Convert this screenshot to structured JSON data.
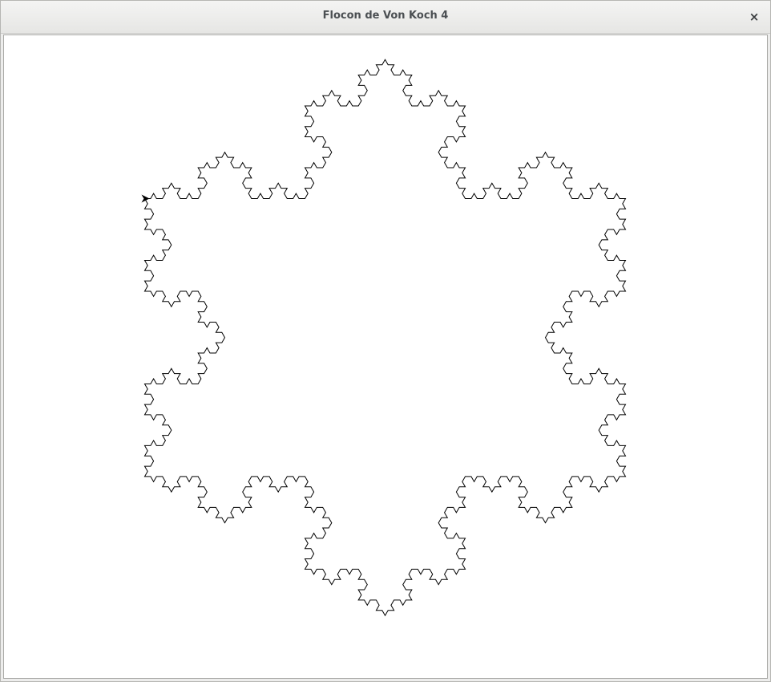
{
  "window": {
    "title": "Flocon de Von Koch 4",
    "close_glyph": "×",
    "close_icon": "close-icon"
  },
  "canvas": {
    "background": "#ffffff",
    "stroke_color": "#000000",
    "fractal": "koch-snowflake",
    "recursion_depth": 4,
    "turtle_icon": "turtle-arrow-icon"
  }
}
